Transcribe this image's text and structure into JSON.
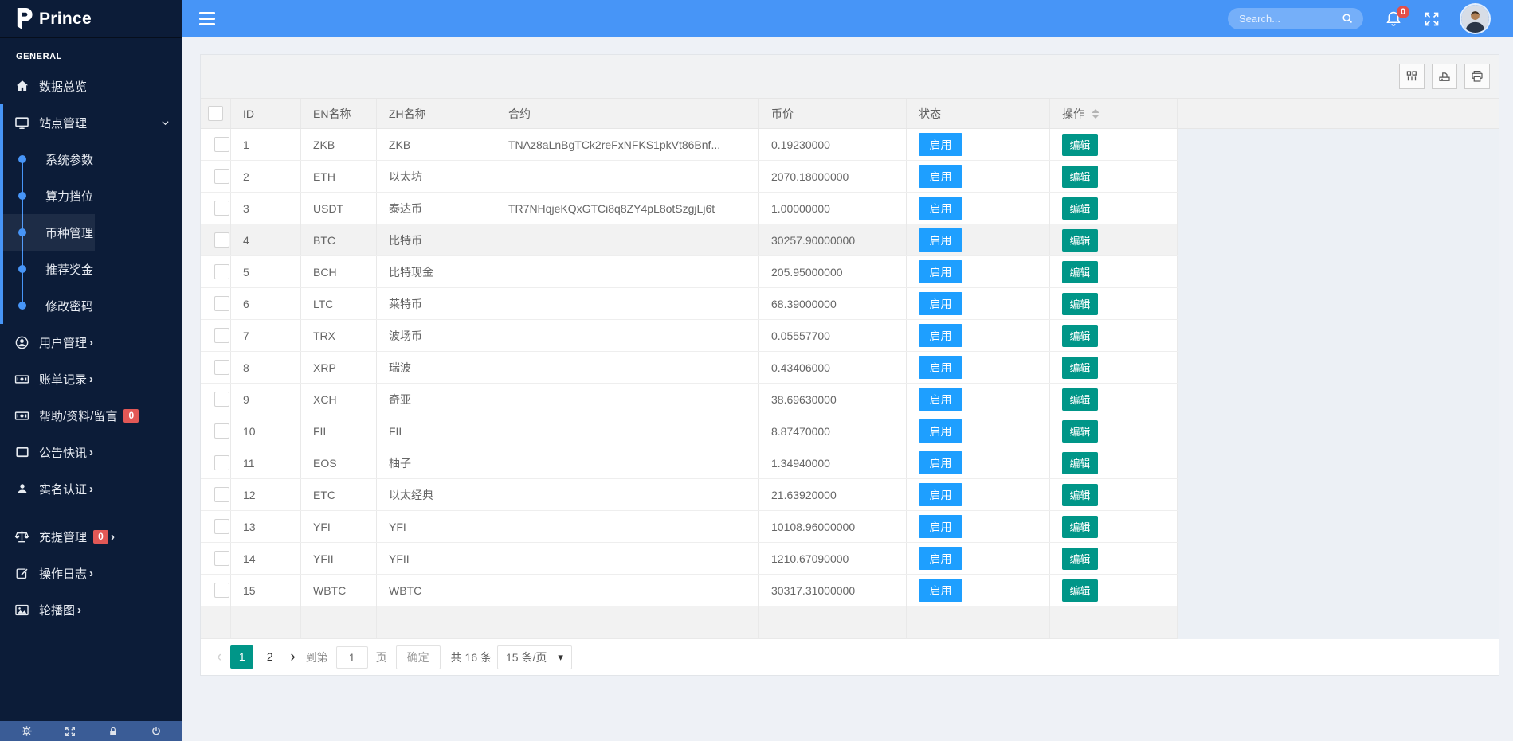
{
  "brand": {
    "name": "Prince"
  },
  "topbar": {
    "search_placeholder": "Search...",
    "notification_badge": "0"
  },
  "sidebar": {
    "section_label": "GENERAL",
    "items": [
      {
        "name": "data-overview",
        "label": "数据总览",
        "icon": "home-icon"
      },
      {
        "name": "site-management",
        "label": "站点管理",
        "icon": "monitor-icon",
        "expanded": true,
        "children": [
          {
            "name": "system-params",
            "label": "系统参数"
          },
          {
            "name": "hashrate-tiers",
            "label": "算力挡位"
          },
          {
            "name": "coin-management",
            "label": "币种管理",
            "active": true
          },
          {
            "name": "referral-bonus",
            "label": "推荐奖金"
          },
          {
            "name": "change-password",
            "label": "修改密码"
          }
        ]
      },
      {
        "name": "user-management",
        "label": "用户管理",
        "icon": "user-icon",
        "arrow": true
      },
      {
        "name": "billing-records",
        "label": "账单记录",
        "icon": "bill-icon",
        "arrow": true
      },
      {
        "name": "help-materials-messages",
        "label": "帮助/资料/留言",
        "icon": "bill-icon",
        "badge": "0"
      },
      {
        "name": "announcements",
        "label": "公告快讯",
        "icon": "window-icon",
        "arrow": true
      },
      {
        "name": "kyc-verification",
        "label": "实名认证",
        "icon": "person-icon",
        "arrow": true
      },
      {
        "name": "deposit-withdraw",
        "label": "充提管理",
        "icon": "scales-icon",
        "badge": "0",
        "arrow": true,
        "gap_before": true
      },
      {
        "name": "operation-logs",
        "label": "操作日志",
        "icon": "edit-icon",
        "arrow": true
      },
      {
        "name": "carousel",
        "label": "轮播图",
        "icon": "image-icon",
        "arrow": true
      }
    ],
    "footer_icons": [
      "gear-icon",
      "expand-icon",
      "lock-icon",
      "power-icon"
    ]
  },
  "toolbar_icons": [
    "columns-filter-icon",
    "export-icon",
    "print-icon"
  ],
  "table": {
    "columns": [
      "ID",
      "EN名称",
      "ZH名称",
      "合约",
      "币价",
      "状态",
      "操作"
    ],
    "status_label": "启用",
    "edit_label": "编辑",
    "rows": [
      {
        "id": "1",
        "en": "ZKB",
        "zh": "ZKB",
        "contract": "TNAz8aLnBgTCk2reFxNFKS1pkVt86Bnf...",
        "price": "0.19230000"
      },
      {
        "id": "2",
        "en": "ETH",
        "zh": "以太坊",
        "contract": "",
        "price": "2070.18000000"
      },
      {
        "id": "3",
        "en": "USDT",
        "zh": "泰达币",
        "contract": "TR7NHqjeKQxGTCi8q8ZY4pL8otSzgjLj6t",
        "price": "1.00000000"
      },
      {
        "id": "4",
        "en": "BTC",
        "zh": "比特币",
        "contract": "",
        "price": "30257.90000000",
        "highlight": true
      },
      {
        "id": "5",
        "en": "BCH",
        "zh": "比特现金",
        "contract": "",
        "price": "205.95000000"
      },
      {
        "id": "6",
        "en": "LTC",
        "zh": "莱特币",
        "contract": "",
        "price": "68.39000000"
      },
      {
        "id": "7",
        "en": "TRX",
        "zh": "波场币",
        "contract": "",
        "price": "0.05557700"
      },
      {
        "id": "8",
        "en": "XRP",
        "zh": "瑞波",
        "contract": "",
        "price": "0.43406000"
      },
      {
        "id": "9",
        "en": "XCH",
        "zh": "奇亚",
        "contract": "",
        "price": "38.69630000"
      },
      {
        "id": "10",
        "en": "FIL",
        "zh": "FIL",
        "contract": "",
        "price": "8.87470000"
      },
      {
        "id": "11",
        "en": "EOS",
        "zh": "柚子",
        "contract": "",
        "price": "1.34940000"
      },
      {
        "id": "12",
        "en": "ETC",
        "zh": "以太经典",
        "contract": "",
        "price": "21.63920000"
      },
      {
        "id": "13",
        "en": "YFI",
        "zh": "YFI",
        "contract": "",
        "price": "10108.96000000"
      },
      {
        "id": "14",
        "en": "YFII",
        "zh": "YFII",
        "contract": "",
        "price": "1210.67090000"
      },
      {
        "id": "15",
        "en": "WBTC",
        "zh": "WBTC",
        "contract": "",
        "price": "30317.31000000"
      }
    ]
  },
  "pagination": {
    "prev": "‹",
    "next": "›",
    "pages": [
      "1",
      "2"
    ],
    "active_page": "1",
    "goto_prefix": "到第",
    "goto_value": "1",
    "goto_suffix": "页",
    "confirm_label": "确定",
    "total_text": "共 16 条",
    "page_size_text": "15 条/页"
  },
  "colors": {
    "topbar_blue": "#4795f7",
    "enable_button_blue": "#1e9fff",
    "action_teal": "#009688",
    "badge_red": "#e25856",
    "sidebar_navy": "#0c1c38",
    "footer_bar_blue": "#3a5c96"
  }
}
